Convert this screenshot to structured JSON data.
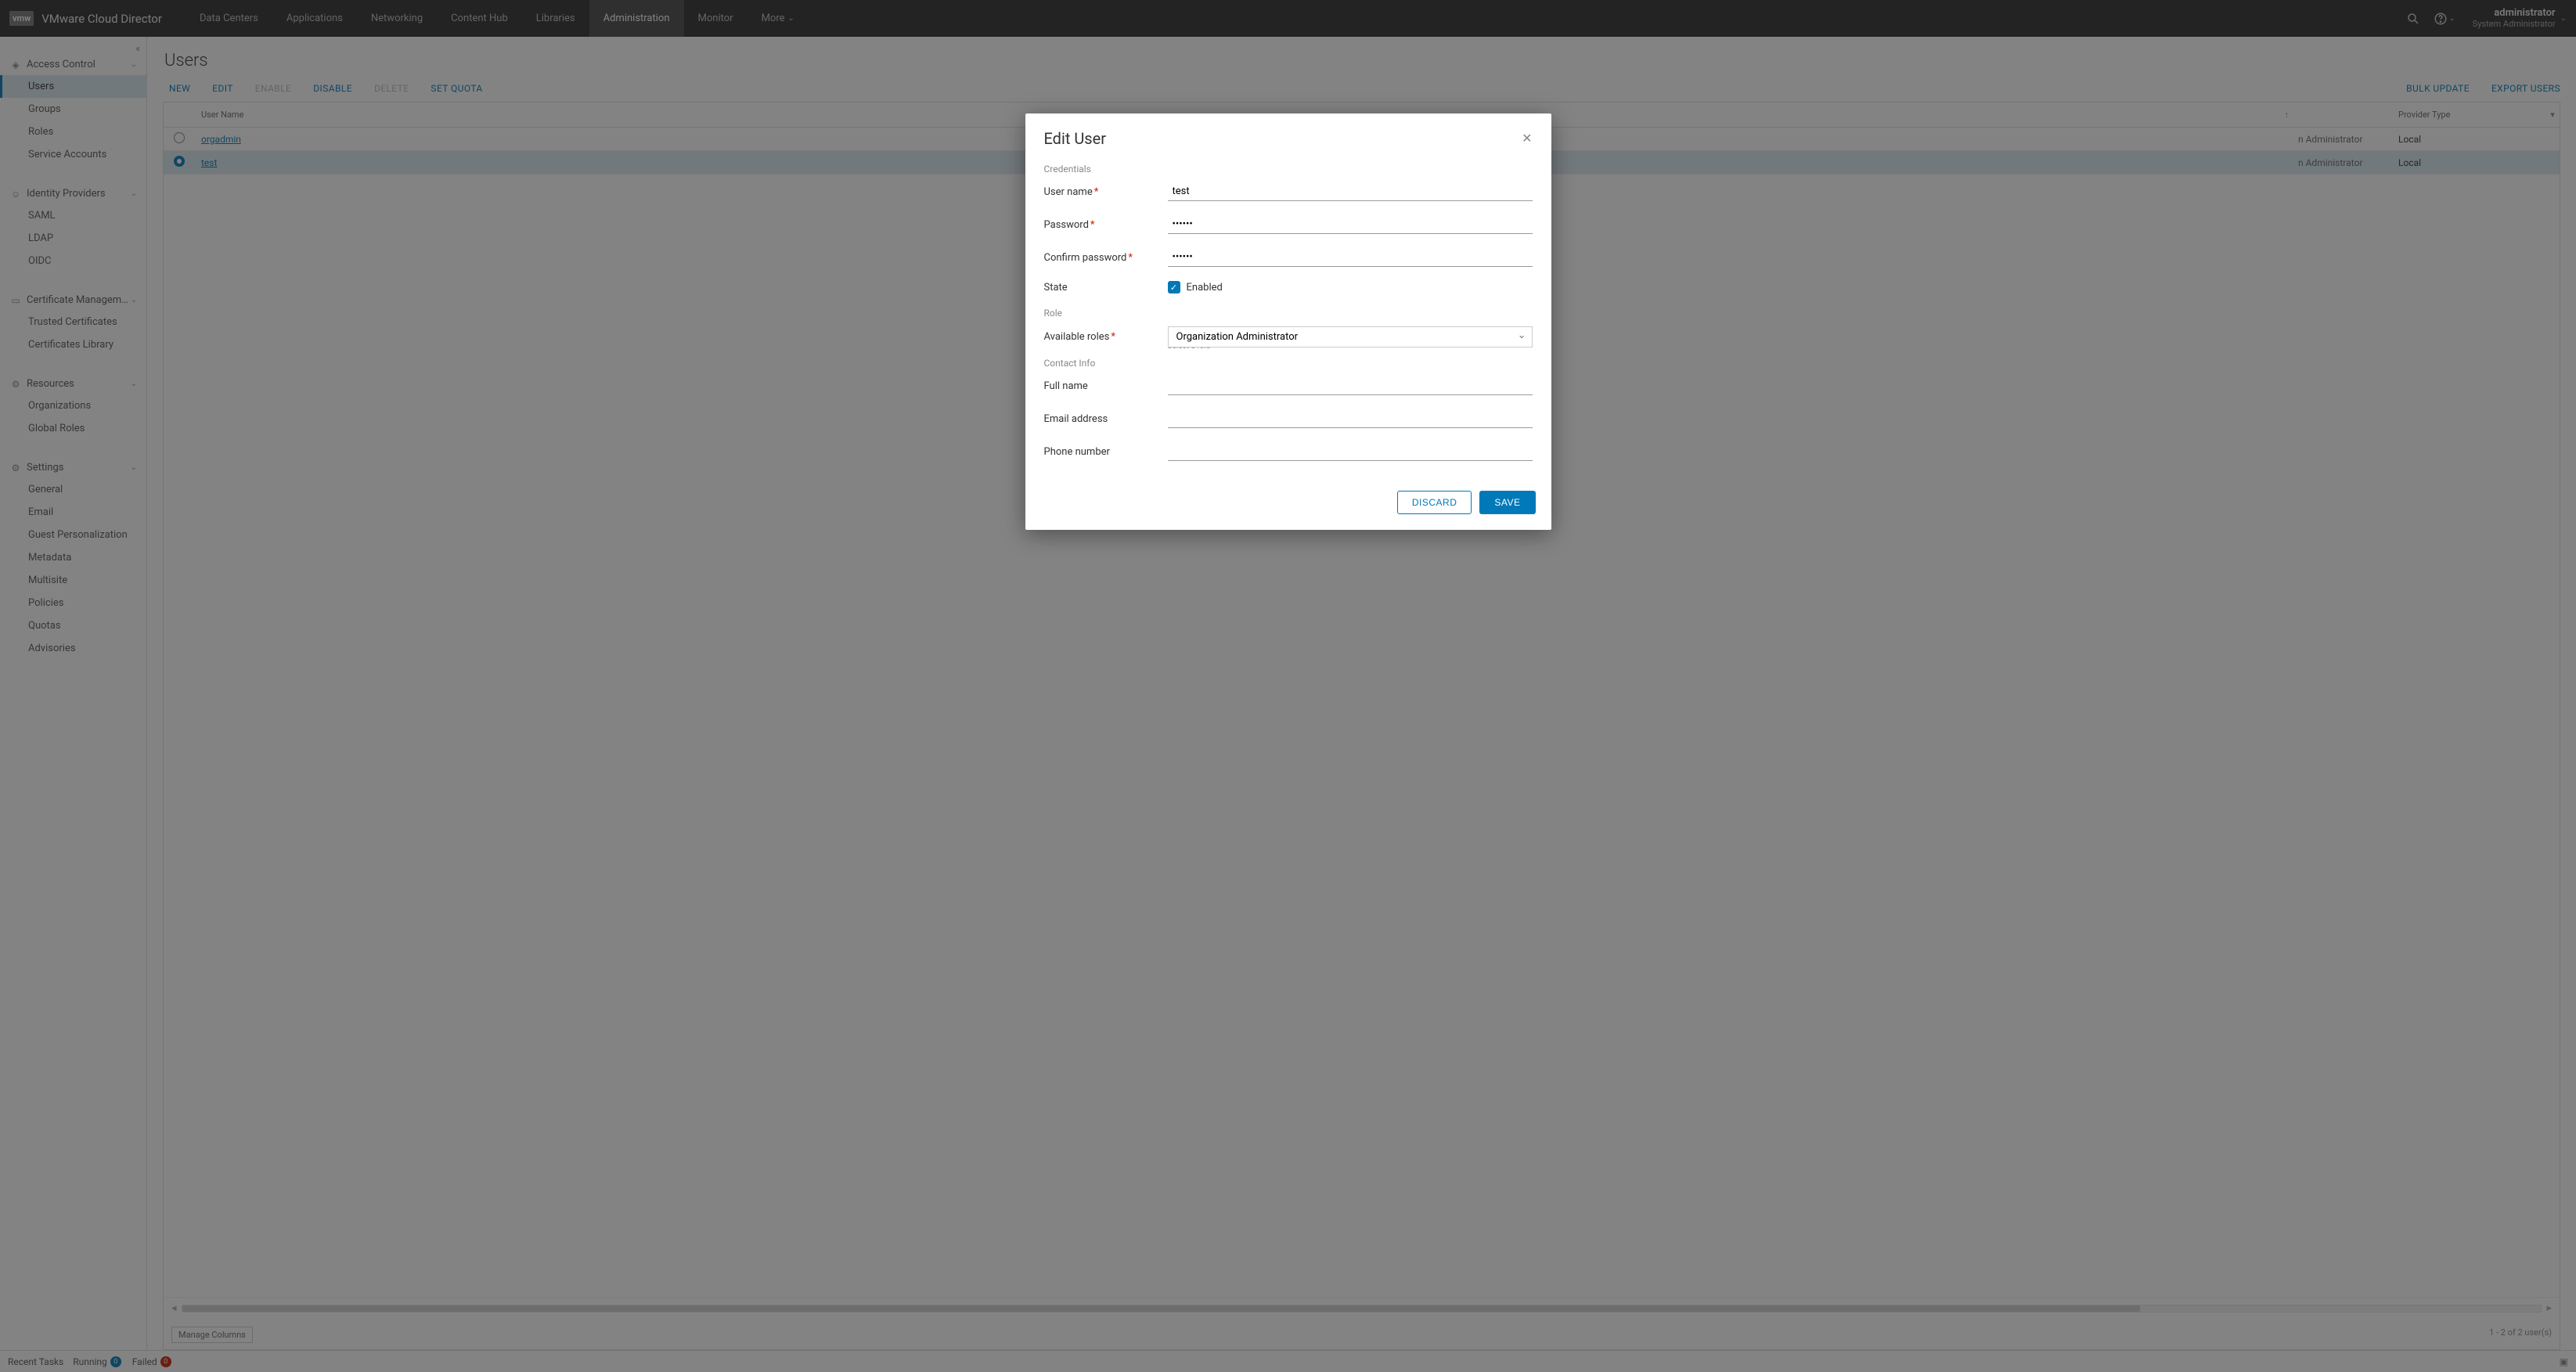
{
  "brand": {
    "logo": "vmw",
    "title": "VMware Cloud Director"
  },
  "topnav": {
    "items": [
      "Data Centers",
      "Applications",
      "Networking",
      "Content Hub",
      "Libraries",
      "Administration",
      "Monitor"
    ],
    "more": "More",
    "active_index": 5
  },
  "user": {
    "name": "administrator",
    "role": "System Administrator"
  },
  "sidebar": {
    "groups": [
      {
        "label": "Access Control",
        "items": [
          "Users",
          "Groups",
          "Roles",
          "Service Accounts"
        ],
        "active_item_index": 0
      },
      {
        "label": "Identity Providers",
        "items": [
          "SAML",
          "LDAP",
          "OIDC"
        ]
      },
      {
        "label": "Certificate Managem…",
        "items": [
          "Trusted Certificates",
          "Certificates Library"
        ]
      },
      {
        "label": "Resources",
        "items": [
          "Organizations",
          "Global Roles"
        ]
      },
      {
        "label": "Settings",
        "items": [
          "General",
          "Email",
          "Guest Personalization",
          "Metadata",
          "Multisite",
          "Policies",
          "Quotas",
          "Advisories"
        ]
      }
    ]
  },
  "page": {
    "title": "Users",
    "toolbar": {
      "new": "NEW",
      "edit": "EDIT",
      "enable": "ENABLE",
      "disable": "DISABLE",
      "delete": "DELETE",
      "set_quota": "SET QUOTA",
      "bulk_update": "BULK UPDATE",
      "export": "EXPORT USERS"
    },
    "columns": {
      "user": "User Name",
      "provider": "Provider Type"
    },
    "rows": [
      {
        "name": "orgadmin",
        "role_hint": "n Administrator",
        "provider": "Local",
        "selected": false
      },
      {
        "name": "test",
        "role_hint": "n Administrator",
        "provider": "Local",
        "selected": true
      }
    ],
    "manage_columns": "Manage Columns",
    "pagination": "1 - 2 of 2 user(s)"
  },
  "dialog": {
    "title": "Edit User",
    "sections": {
      "credentials": "Credentials",
      "role": "Role",
      "contact": "Contact Info"
    },
    "fields": {
      "username_label": "User name",
      "username_value": "test",
      "password_label": "Password",
      "password_value": "••••••",
      "confirm_label": "Confirm password",
      "confirm_value": "••••••",
      "state_label": "State",
      "state_checkbox": "Enabled",
      "roles_label": "Available roles",
      "roles_value": "Organization Administrator",
      "roles_helper": "Select a role",
      "fullname_label": "Full name",
      "fullname_value": "",
      "email_label": "Email address",
      "email_value": "",
      "phone_label": "Phone number",
      "phone_value": ""
    },
    "buttons": {
      "discard": "DISCARD",
      "save": "SAVE"
    }
  },
  "bottombar": {
    "recent": "Recent Tasks",
    "running": "Running",
    "running_count": "0",
    "failed": "Failed",
    "failed_count": "0"
  }
}
